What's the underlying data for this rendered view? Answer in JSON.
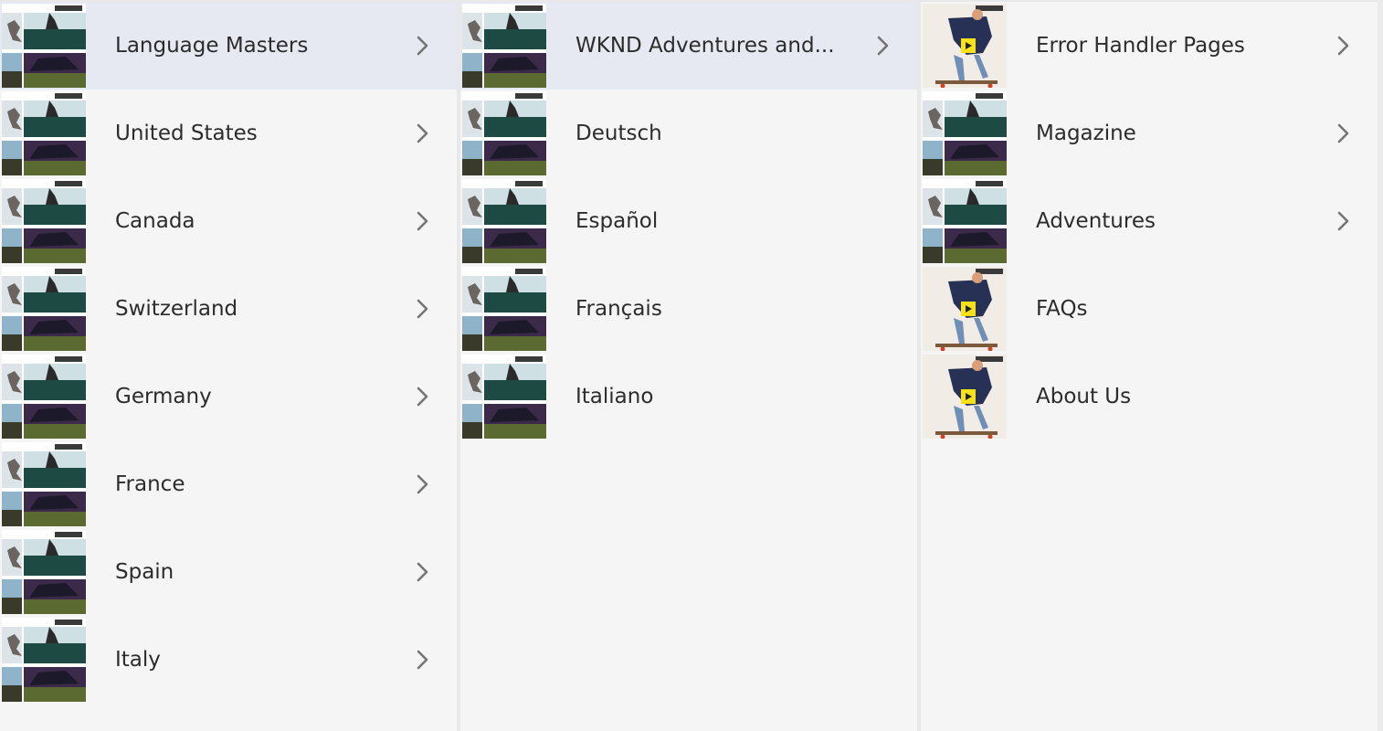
{
  "colors": {
    "column_bg": "#f5f5f5",
    "selected_bg": "#e6e9f1",
    "text": "#2c2c2c",
    "chevron": "#747474"
  },
  "columns": [
    {
      "items": [
        {
          "label": "Language Masters",
          "thumbnail": "collage-thumbnail",
          "has_children": true,
          "selected": true
        },
        {
          "label": "United States",
          "thumbnail": "collage-thumbnail",
          "has_children": true,
          "selected": false
        },
        {
          "label": "Canada",
          "thumbnail": "collage-thumbnail",
          "has_children": true,
          "selected": false
        },
        {
          "label": "Switzerland",
          "thumbnail": "collage-thumbnail",
          "has_children": true,
          "selected": false
        },
        {
          "label": "Germany",
          "thumbnail": "collage-thumbnail",
          "has_children": true,
          "selected": false
        },
        {
          "label": "France",
          "thumbnail": "collage-thumbnail",
          "has_children": true,
          "selected": false
        },
        {
          "label": "Spain",
          "thumbnail": "collage-thumbnail",
          "has_children": true,
          "selected": false
        },
        {
          "label": "Italy",
          "thumbnail": "collage-thumbnail",
          "has_children": true,
          "selected": false
        }
      ]
    },
    {
      "items": [
        {
          "label": "WKND Adventures and...",
          "thumbnail": "collage-thumbnail",
          "has_children": true,
          "selected": true
        },
        {
          "label": "Deutsch",
          "thumbnail": "collage-thumbnail",
          "has_children": false,
          "selected": false
        },
        {
          "label": "Español",
          "thumbnail": "collage-thumbnail",
          "has_children": false,
          "selected": false
        },
        {
          "label": "Français",
          "thumbnail": "collage-thumbnail",
          "has_children": false,
          "selected": false
        },
        {
          "label": "Italiano",
          "thumbnail": "collage-thumbnail",
          "has_children": false,
          "selected": false
        }
      ]
    },
    {
      "items": [
        {
          "label": "Error Handler Pages",
          "thumbnail": "skater-thumbnail",
          "has_children": true,
          "selected": false
        },
        {
          "label": "Magazine",
          "thumbnail": "collage-thumbnail",
          "has_children": true,
          "selected": false
        },
        {
          "label": "Adventures",
          "thumbnail": "collage-thumbnail",
          "has_children": true,
          "selected": false
        },
        {
          "label": "FAQs",
          "thumbnail": "skater-thumbnail",
          "has_children": false,
          "selected": false
        },
        {
          "label": "About Us",
          "thumbnail": "skater-thumbnail",
          "has_children": false,
          "selected": false
        }
      ]
    }
  ]
}
